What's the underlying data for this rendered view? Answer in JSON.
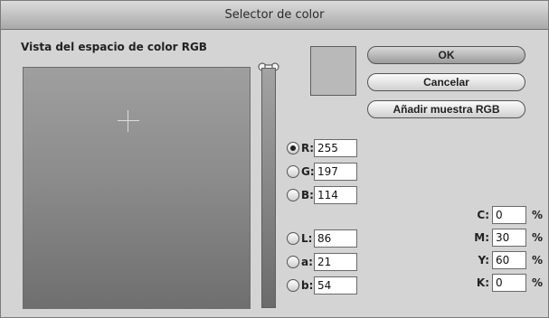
{
  "window": {
    "title": "Selector de color"
  },
  "picker": {
    "section_label": "Vista del espacio de color RGB"
  },
  "preview": {
    "color": "#b9b9b9"
  },
  "buttons": {
    "ok": "OK",
    "cancel": "Cancelar",
    "add_swatch": "Añadir muestra RGB"
  },
  "rgb": [
    {
      "label": "R:",
      "value": "255",
      "checked": true
    },
    {
      "label": "G:",
      "value": "197",
      "checked": false
    },
    {
      "label": "B:",
      "value": "114",
      "checked": false
    }
  ],
  "lab": [
    {
      "label": "L:",
      "value": "86",
      "checked": false
    },
    {
      "label": "a:",
      "value": "21",
      "checked": false
    },
    {
      "label": "b:",
      "value": "54",
      "checked": false
    }
  ],
  "cmyk": [
    {
      "label": "C:",
      "value": "0",
      "unit": "%"
    },
    {
      "label": "M:",
      "value": "30",
      "unit": "%"
    },
    {
      "label": "Y:",
      "value": "60",
      "unit": "%"
    },
    {
      "label": "K:",
      "value": "0",
      "unit": "%"
    }
  ]
}
